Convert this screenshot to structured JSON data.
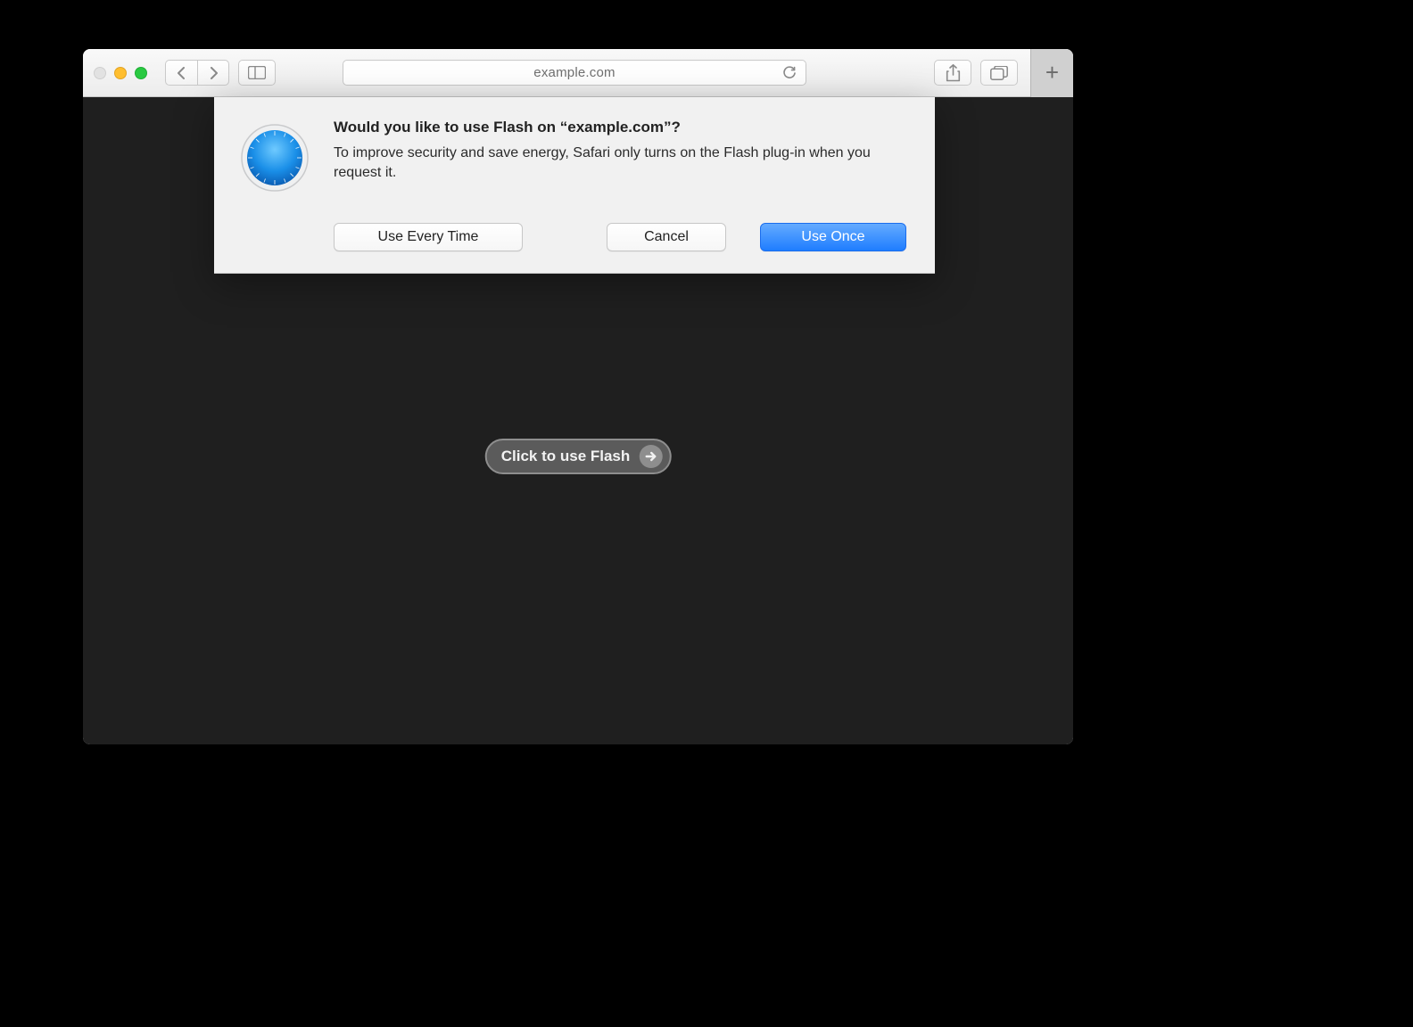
{
  "address_bar": {
    "url_text": "example.com"
  },
  "dialog": {
    "title": "Would you like to use Flash on “example.com”?",
    "message": "To improve security and save energy, Safari only turns on the Flash plug-in when you request it.",
    "buttons": {
      "use_every_time": "Use Every Time",
      "cancel": "Cancel",
      "use_once": "Use Once"
    }
  },
  "content": {
    "flash_prompt": "Click to use Flash"
  }
}
